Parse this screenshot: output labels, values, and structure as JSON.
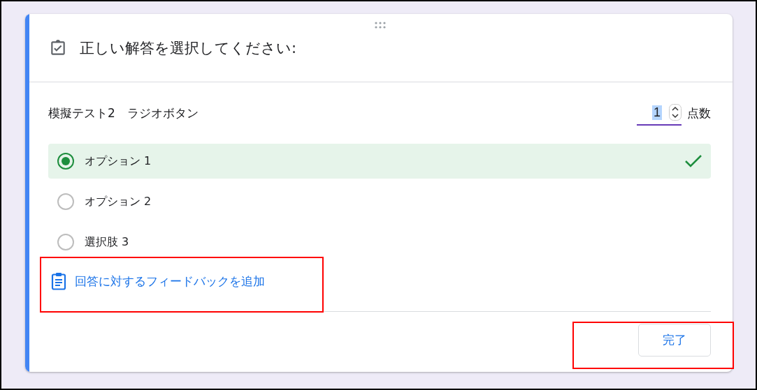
{
  "card": {
    "title": "正しい解答を選択してください:"
  },
  "question": {
    "label": "模擬テスト2　ラジオボタン",
    "points": {
      "value": "1",
      "label": "点数"
    }
  },
  "options": [
    {
      "label": "オプション 1",
      "selected": true,
      "correct": true
    },
    {
      "label": "オプション 2",
      "selected": false,
      "correct": false
    },
    {
      "label": "選択肢 3",
      "selected": false,
      "correct": false
    }
  ],
  "feedback_link": "回答に対するフィードバックを追加",
  "done_button": "完了"
}
